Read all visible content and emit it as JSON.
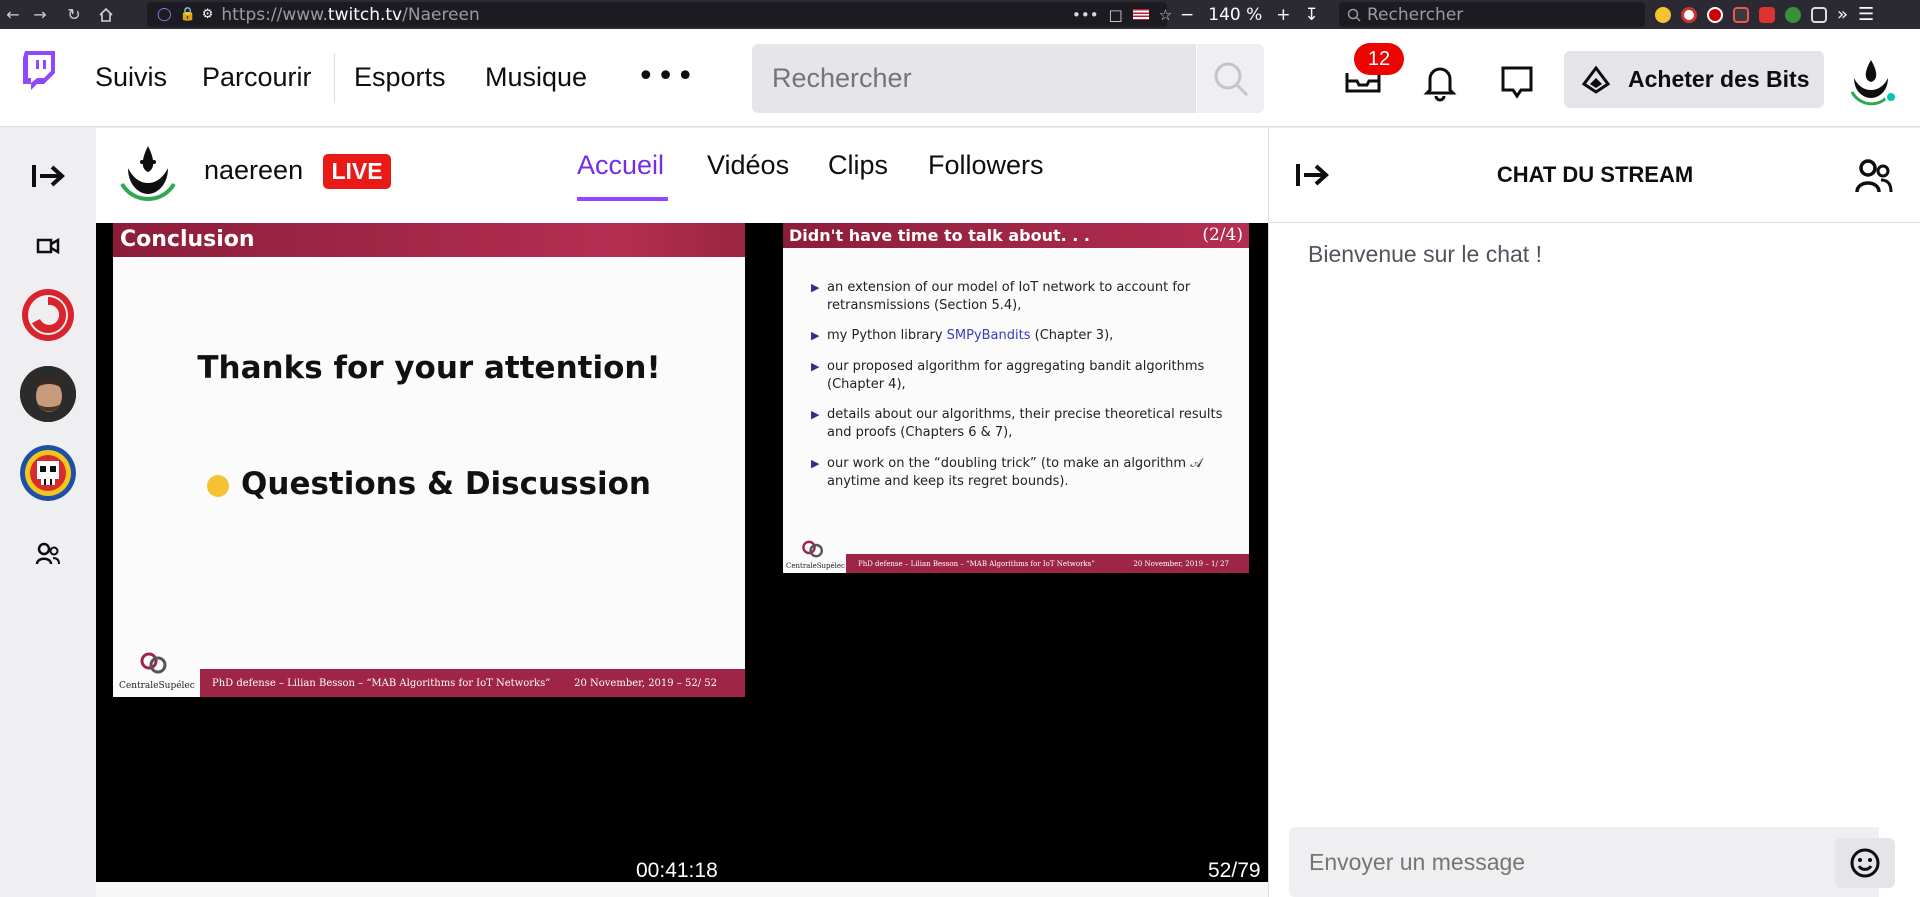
{
  "browser": {
    "url_prefix": "https://www.",
    "url_domain": "twitch.tv",
    "url_path": "/Naereen",
    "zoom": "140 %",
    "search_placeholder": "Rechercher",
    "more_glyph": "»"
  },
  "nav": {
    "links": [
      "Suivis",
      "Parcourir",
      "Esports",
      "Musique"
    ],
    "more": "•••",
    "search_placeholder": "Rechercher",
    "inbox_count": "12",
    "bits_label": "Acheter des Bits"
  },
  "channel": {
    "name": "naereen",
    "live_label": "LIVE",
    "tabs": [
      "Accueil",
      "Vidéos",
      "Clips",
      "Followers"
    ],
    "active_tab": "Accueil"
  },
  "player": {
    "slide1": {
      "title": "Conclusion",
      "line1": "Thanks for your attention!",
      "line2": "Questions & Discussion",
      "logo_text": "CentraleSupélec",
      "footer_left": "PhD defense – Lilian Besson – “MAB Algorithms for IoT Networks”",
      "footer_right": "20 November, 2019 – 52/ 52"
    },
    "slide2": {
      "title": "Didn't have time to talk about. . .",
      "page": "(2/4)",
      "bullets": [
        "an extension of our model of IoT network to account for retransmissions (Section 5.4),",
        "my Python library SMPyBandits (Chapter 3),",
        "our proposed algorithm for aggregating bandit algorithms (Chapter 4),",
        "details about our algorithms, their precise theoretical results and proofs (Chapters 6 & 7),",
        "our work on the “doubling trick” (to make an algorithm 𝒜 anytime and keep its regret bounds)."
      ],
      "bullet2_pre": "my Python library ",
      "bullet2_link": "SMPyBandits",
      "bullet2_post": " (Chapter 3),",
      "logo_text": "CentraleSupélec",
      "footer_left": "PhD defense – Lilian Besson – “MAB Algorithms for IoT Networks”",
      "footer_right": "20 November, 2019 – 1/ 27"
    },
    "timecode": "00:41:18",
    "slide_counter": "52/79"
  },
  "chat": {
    "title": "CHAT DU STREAM",
    "welcome": "Bienvenue sur le chat !",
    "input_placeholder": "Envoyer un message"
  },
  "colors": {
    "twitch_purple": "#9147ff",
    "live_red": "#e91916",
    "badge_red": "#eb0400",
    "slide_maroon": "#9e2546"
  }
}
